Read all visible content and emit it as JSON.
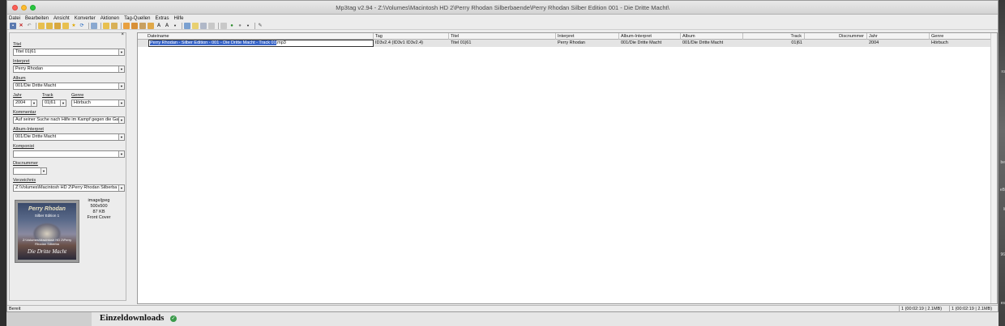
{
  "window": {
    "title": "Mp3tag v2.94  -  Z:\\Volumes\\Macintosh HD 2\\Perry Rhodan Silberbaende\\Perry Rhodan Silber Edition 001 - Die Dritte Macht\\"
  },
  "menu": [
    "Datei",
    "Bearbeiten",
    "Ansicht",
    "Konverter",
    "Aktionen",
    "Tag-Quellen",
    "Extras",
    "Hilfe"
  ],
  "panel": {
    "close": "×",
    "fields": {
      "titel": {
        "label": "Titel",
        "value": "Titel 01|61"
      },
      "interpret": {
        "label": "Interpret",
        "value": "Perry Rhodan"
      },
      "album": {
        "label": "Album",
        "value": "001/Die Dritte Macht"
      },
      "jahr": {
        "label": "Jahr",
        "value": "2004"
      },
      "track": {
        "label": "Track",
        "value": "01|61"
      },
      "genre": {
        "label": "Genre",
        "value": "Hörbuch"
      },
      "kommentar": {
        "label": "Kommentar",
        "value": "Auf seiner Suche nach Hilfe im Kampf gegen die Ga"
      },
      "albuminterpret": {
        "label": "Album-Interpret",
        "value": "001/Die Dritte Macht"
      },
      "komponist": {
        "label": "Komponist",
        "value": ""
      },
      "discnummer": {
        "label": "Discnummer",
        "value": ""
      },
      "verzeichnis": {
        "label": "Verzeichnis",
        "value": "Z:\\Volumes\\Macintosh HD 2\\Perry Rhodan Silberba"
      }
    },
    "cover": {
      "title": "Perry Rhodan",
      "subtitle": "Silber Edition 1",
      "label": "Die Dritte Macht",
      "small": "Z:\\Volumes\\Macintosh HD 2\\Perry Rhodan Silberba",
      "info": [
        "image/jpeg",
        "500x500",
        "87 KB",
        "Front Cover"
      ]
    }
  },
  "grid": {
    "columns": [
      "Dateiname",
      "Tag",
      "Titel",
      "Interpret",
      "Album-Interpret",
      "Album",
      "Track",
      "Discnummer",
      "Jahr",
      "Genre"
    ],
    "rows": [
      {
        "dateiname_sel": "Perry Rhodan - Silber Edition - 001 - Die Dritte Macht - Track 01",
        "dateiname_ext": ".mp3",
        "tag": "ID3v2.4 (ID3v1 ID3v2.4)",
        "titel": "Titel 01|61",
        "interpret": "Perry Rhodan",
        "albuminterpret": "001/Die Dritte Macht",
        "album": "001/Die Dritte Macht",
        "track": "01|61",
        "discnummer": "",
        "jahr": "2004",
        "genre": "Hörbuch"
      }
    ]
  },
  "status": {
    "label": "Bereit",
    "box1": "1 (00:02:19 | 2.1MB)",
    "box2": "1 (00:02:19 | 2.1MB)"
  },
  "background": {
    "heading": "Einzeldownloads",
    "right_snippets": [
      "ro",
      "be",
      "eB",
      "li",
      "96",
      "es"
    ]
  }
}
